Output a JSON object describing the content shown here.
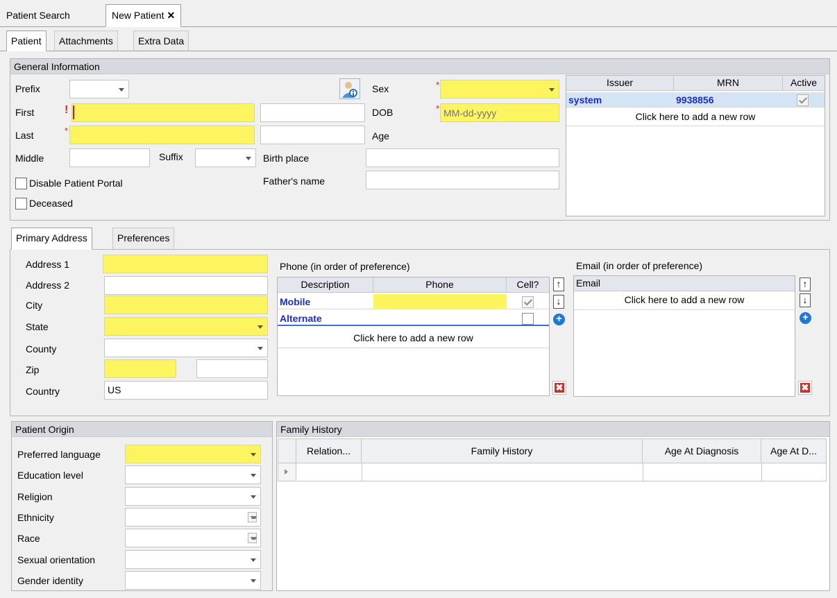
{
  "doc_tabs": [
    "Patient Search",
    "New Patient"
  ],
  "inner_tabs": [
    "Patient",
    "Attachments",
    "Extra Data"
  ],
  "general": {
    "header": "General Information",
    "prefix_label": "Prefix",
    "first_label": "First",
    "last_label": "Last",
    "middle_label": "Middle",
    "suffix_label": "Suffix",
    "disable_portal_label": "Disable Patient Portal",
    "deceased_label": "Deceased",
    "sex_label": "Sex",
    "dob_label": "DOB",
    "dob_placeholder": "MM-dd-yyyy",
    "age_label": "Age",
    "birth_place_label": "Birth place",
    "fathers_name_label": "Father's name"
  },
  "mrn_grid": {
    "columns": [
      "Issuer",
      "MRN",
      "Active"
    ],
    "rows": [
      {
        "issuer": "system",
        "mrn": "9938856",
        "active": true
      }
    ],
    "add_row": "Click here to add a new row"
  },
  "address_tabs": [
    "Primary Address",
    "Preferences"
  ],
  "address": {
    "address1_label": "Address 1",
    "address2_label": "Address 2",
    "city_label": "City",
    "state_label": "State",
    "county_label": "County",
    "zip_label": "Zip",
    "country_label": "Country",
    "country_value": "US"
  },
  "phone": {
    "title": "Phone (in order of preference)",
    "columns": [
      "Description",
      "Phone",
      "Cell?"
    ],
    "rows": [
      {
        "description": "Mobile",
        "cell": true
      },
      {
        "description": "Alternate",
        "cell": false
      }
    ],
    "add_row": "Click here to add a new row"
  },
  "email": {
    "title": "Email (in order of preference)",
    "column": "Email",
    "add_row": "Click here to add a new row"
  },
  "buttons": {
    "up": "↑",
    "down": "↓",
    "add": "+",
    "delete": "✖"
  },
  "origin": {
    "header": "Patient Origin",
    "fields": [
      "Preferred language",
      "Education level",
      "Religion",
      "Ethnicity",
      "Race",
      "Sexual orientation",
      "Gender identity"
    ]
  },
  "family": {
    "header": "Family History",
    "columns": [
      "Relation...",
      "Family History",
      "Age At Diagnosis",
      "Age At D..."
    ]
  },
  "icons": {
    "close": "close-icon",
    "patient_lookup": "patient-lookup-icon"
  },
  "colors": {
    "required": "#fdf55f",
    "link": "#1a2bd0",
    "selected_row": "#d4e4f5",
    "delete": "#d42c25",
    "add": "#1e78d4"
  }
}
